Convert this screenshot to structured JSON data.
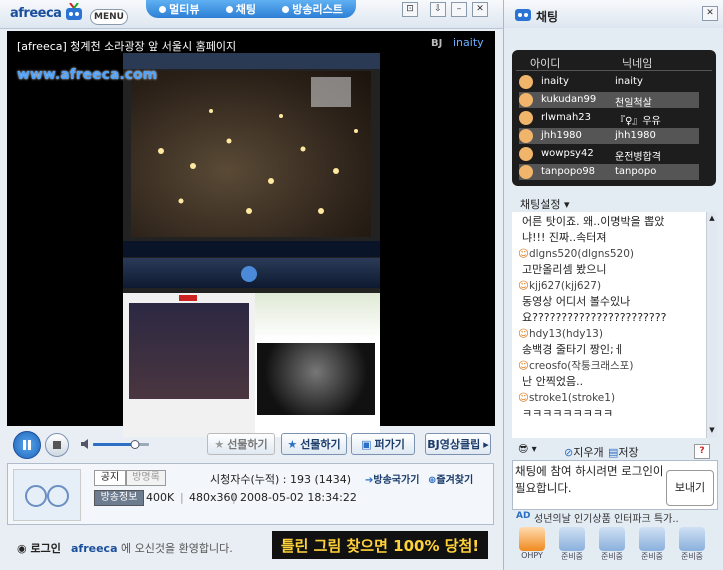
{
  "topbar": {
    "logo": "afreeca",
    "menu_label": "MENU",
    "tabs": [
      "멀티뷰",
      "채팅",
      "방송리스트"
    ]
  },
  "player": {
    "title": "[afreeca] 청계천 소라광장 앞 서울시 홈페이지",
    "bj_label": "BJ",
    "bj_name": "inaity",
    "watermark_url": "www.afreeca.com"
  },
  "controls": {
    "gift_disabled": "선물하기",
    "gift": "선물하기",
    "share": "퍼가기",
    "bj_clip": "BJ영상클립"
  },
  "info": {
    "notice_badge": "공지",
    "guestbook_badge": "방명록",
    "viewers_label": "시청자수(누적) : 193 (1434)",
    "visit_link": "방송국가기",
    "favorite_link": "즐겨찾기",
    "broadcast_info_badge": "방송정보",
    "bitrate": "400K",
    "resolution": "480x360",
    "datetime": "2008-05-02 18:34:22"
  },
  "bottom": {
    "login_label": "로그인",
    "welcome_brand": "afreeca",
    "welcome_text": "에 오신것을 환영합니다.",
    "banner_text": "틀린 그림 찾으면 100% 당첨!"
  },
  "chat": {
    "title": "채팅",
    "col_id": "아이디",
    "col_nick": "닉네임",
    "users": [
      {
        "id": "inaity",
        "nick": "inaity"
      },
      {
        "id": "kukudan99",
        "nick": "천일척살"
      },
      {
        "id": "rlwmah23",
        "nick": "『♀』우유"
      },
      {
        "id": "jhh1980",
        "nick": "jhh1980"
      },
      {
        "id": "wowpsy42",
        "nick": "운전병합격"
      },
      {
        "id": "tanpopo98",
        "nick": "tanpopo"
      }
    ],
    "settings_label": "채팅설정",
    "messages": [
      {
        "type": "text",
        "text": "어른 탓이죠. 왜..이명박을 뽑았"
      },
      {
        "type": "text",
        "text": "냐!!! 진짜..속터져"
      },
      {
        "type": "user",
        "text": "dlgns520(dlgns520)"
      },
      {
        "type": "text",
        "text": "고만올리셈 봤으니"
      },
      {
        "type": "user",
        "text": "kjj627(kjj627)"
      },
      {
        "type": "text",
        "text": "동영상 어디서 볼수있나"
      },
      {
        "type": "text",
        "text": "요???????????????????????"
      },
      {
        "type": "user",
        "text": "hdy13(hdy13)"
      },
      {
        "type": "text",
        "text": "송백경 줄타기 짱인;ㅔ"
      },
      {
        "type": "user",
        "text": "creosfo(작퉁크래스포)"
      },
      {
        "type": "text",
        "text": "난 안찍었음.."
      },
      {
        "type": "user",
        "text": "stroke1(stroke1)"
      },
      {
        "type": "text",
        "text": "ㅋㅋㅋㅋㅋㅋㅋㅋㅋ"
      }
    ],
    "clear_label": "지우개",
    "save_label": "저장",
    "input_placeholder": "채팅에 참여 하시려면 로그인이 필요합니다.",
    "send_label": "보내기",
    "ad_badge": "AD",
    "ad_text": "성년의날 인기상품 인터파크 특가..",
    "bottom_icons": [
      "OHPY",
      "준비중",
      "준비중",
      "준비중",
      "준비중"
    ]
  }
}
